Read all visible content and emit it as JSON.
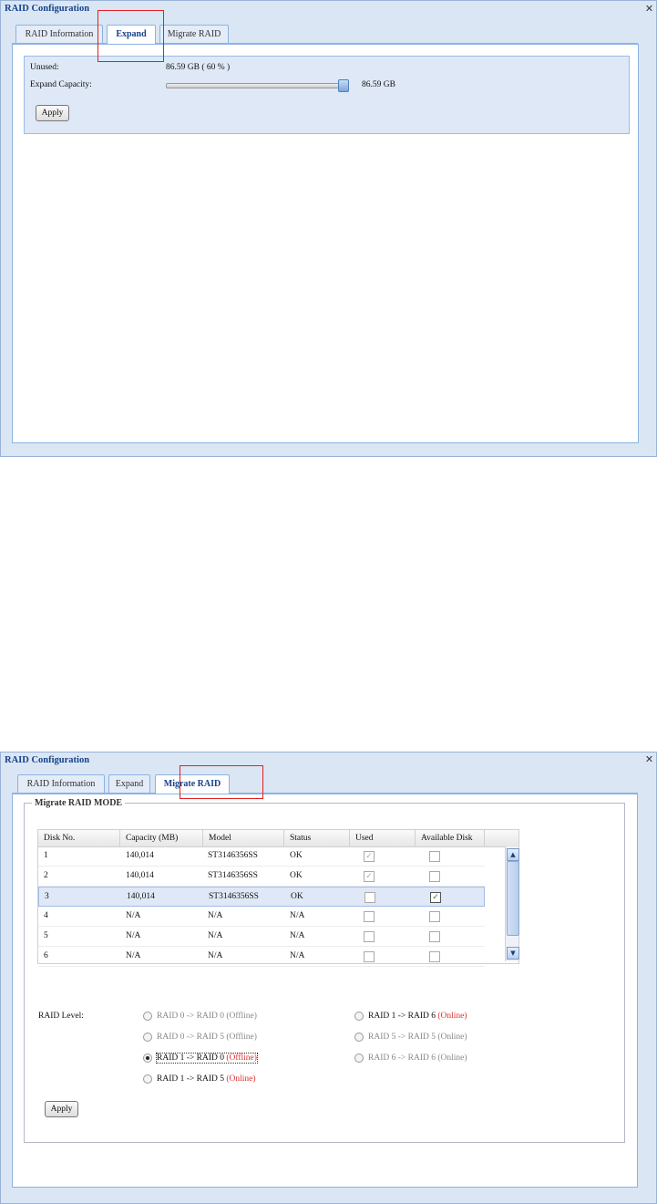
{
  "top": {
    "window_title": "RAID Configuration",
    "tabs": [
      "RAID Information",
      "Expand",
      "Migrate RAID"
    ],
    "active_tab": "Expand",
    "unused_label": "Unused:",
    "unused_value": "86.59 GB ( 60 % )",
    "expand_label": "Expand Capacity:",
    "expand_value": "86.59 GB",
    "slider_level_percent": 100,
    "apply_label": "Apply"
  },
  "bottom": {
    "window_title": "RAID Configuration",
    "tabs": [
      "RAID Information",
      "Expand",
      "Migrate RAID"
    ],
    "active_tab": "Migrate RAID",
    "group_title": "Migrate RAID MODE",
    "columns": [
      "Disk No.",
      "Capacity (MB)",
      "Model",
      "Status",
      "Used",
      "Available Disk"
    ],
    "rows": [
      {
        "disk": "1",
        "capacity": "140,014",
        "model": "ST3146356SS",
        "status": "OK",
        "used": true,
        "available": false
      },
      {
        "disk": "2",
        "capacity": "140,014",
        "model": "ST3146356SS",
        "status": "OK",
        "used": true,
        "available": false
      },
      {
        "disk": "3",
        "capacity": "140,014",
        "model": "ST3146356SS",
        "status": "OK",
        "used": false,
        "available": true
      },
      {
        "disk": "4",
        "capacity": "N/A",
        "model": "N/A",
        "status": "N/A",
        "used": false,
        "available": false
      },
      {
        "disk": "5",
        "capacity": "N/A",
        "model": "N/A",
        "status": "N/A",
        "used": false,
        "available": false
      },
      {
        "disk": "6",
        "capacity": "N/A",
        "model": "N/A",
        "status": "N/A",
        "used": false,
        "available": false
      }
    ],
    "raid_level_label": "RAID Level:",
    "options": [
      {
        "text": "RAID 0 -> RAID 0",
        "mode": "(Offline)",
        "enabled": false,
        "checked": false
      },
      {
        "text": "RAID 0 -> RAID 5",
        "mode": "(Offline)",
        "enabled": false,
        "checked": false
      },
      {
        "text": "RAID 1 -> RAID 0",
        "mode": "(Offline)",
        "enabled": true,
        "checked": true
      },
      {
        "text": "RAID 1 -> RAID 5",
        "mode": "(Online)",
        "enabled": true,
        "checked": false
      },
      {
        "text": "RAID 1 -> RAID 6",
        "mode": "(Online)",
        "enabled": true,
        "checked": false
      },
      {
        "text": "RAID 5 -> RAID 5",
        "mode": "(Online)",
        "enabled": false,
        "checked": false
      },
      {
        "text": "RAID 6 -> RAID 6",
        "mode": "(Online)",
        "enabled": false,
        "checked": false
      }
    ],
    "apply_label": "Apply"
  },
  "icons": {
    "close": "close-icon",
    "scroll_up": "scroll-up-arrow-icon",
    "scroll_down": "scroll-down-arrow-icon",
    "check": "checkmark-icon"
  },
  "colors": {
    "window_bg": "#dbe6f4",
    "title": "#15428b",
    "highlight_box": "#e02020",
    "online_text": "#e03030"
  }
}
